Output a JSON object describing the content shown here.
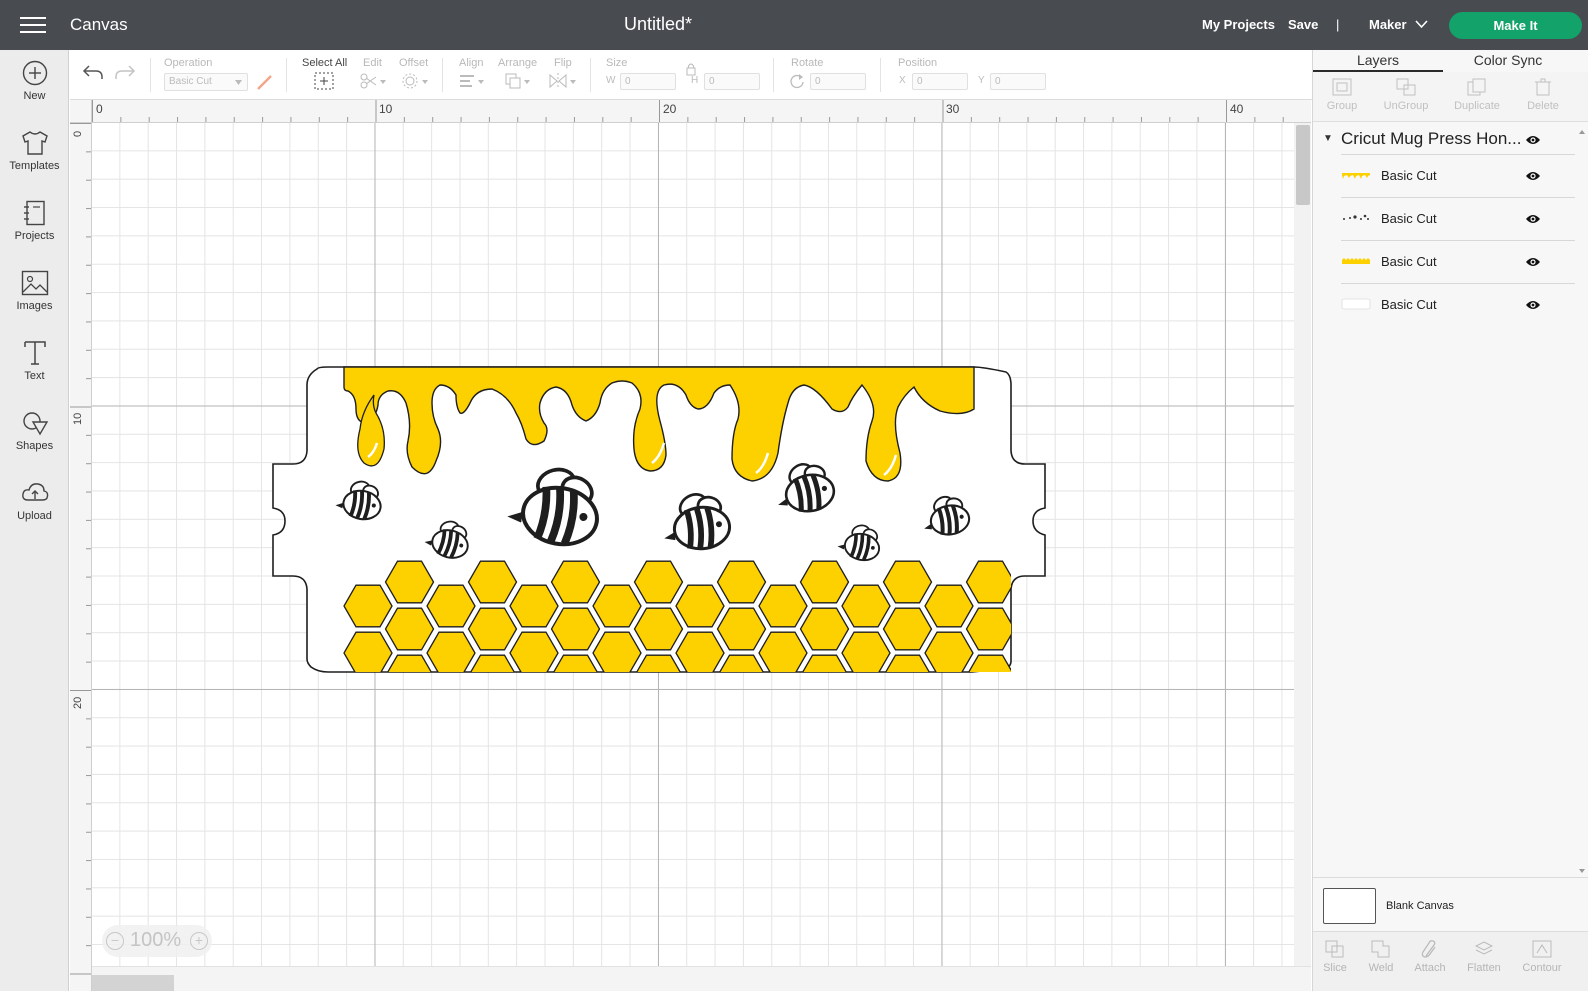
{
  "header": {
    "app_name": "Canvas",
    "doc_title": "Untitled*",
    "my_projects": "My Projects",
    "save": "Save",
    "separator": "|",
    "machine": "Maker",
    "make_it": "Make It"
  },
  "sidebar": {
    "items": [
      {
        "label": "New",
        "icon": "plus-circle-icon"
      },
      {
        "label": "Templates",
        "icon": "tshirt-icon"
      },
      {
        "label": "Projects",
        "icon": "notebook-icon"
      },
      {
        "label": "Images",
        "icon": "image-icon"
      },
      {
        "label": "Text",
        "icon": "text-t-icon"
      },
      {
        "label": "Shapes",
        "icon": "shapes-icon"
      },
      {
        "label": "Upload",
        "icon": "cloud-upload-icon"
      }
    ]
  },
  "toolbar": {
    "operation_label": "Operation",
    "operation_value": "Basic Cut",
    "select_all": "Select All",
    "edit": "Edit",
    "offset": "Offset",
    "align": "Align",
    "arrange": "Arrange",
    "flip": "Flip",
    "size": "Size",
    "w": "W",
    "w_value": "0",
    "h": "H",
    "h_value": "0",
    "rotate": "Rotate",
    "rotate_value": "0",
    "position": "Position",
    "x": "X",
    "x_value": "0",
    "y": "Y",
    "y_value": "0"
  },
  "rulers": {
    "top": [
      "0",
      "10",
      "20",
      "30",
      "40"
    ],
    "left": [
      "0",
      "10",
      "20"
    ]
  },
  "zoom": {
    "value": "100%",
    "minus": "−",
    "plus": "+"
  },
  "panel": {
    "tabs": [
      "Layers",
      "Color Sync"
    ],
    "tools": [
      "Group",
      "UnGroup",
      "Duplicate",
      "Delete"
    ],
    "group_name": "Cricut Mug Press Hon...",
    "layers": [
      {
        "name": "Basic Cut",
        "thumb": "drips-thumb"
      },
      {
        "name": "Basic Cut",
        "thumb": "bees-thumb"
      },
      {
        "name": "Basic Cut",
        "thumb": "honeycomb-thumb"
      },
      {
        "name": "Basic Cut",
        "thumb": "blank-shape-thumb"
      }
    ],
    "blank_canvas": "Blank Canvas",
    "bottom_tools": [
      "Slice",
      "Weld",
      "Attach",
      "Flatten",
      "Contour"
    ]
  },
  "colors": {
    "topbar": "#484b50",
    "make_it": "#12a26a",
    "honey": "#fdd000",
    "outline": "#1e1e1e"
  }
}
